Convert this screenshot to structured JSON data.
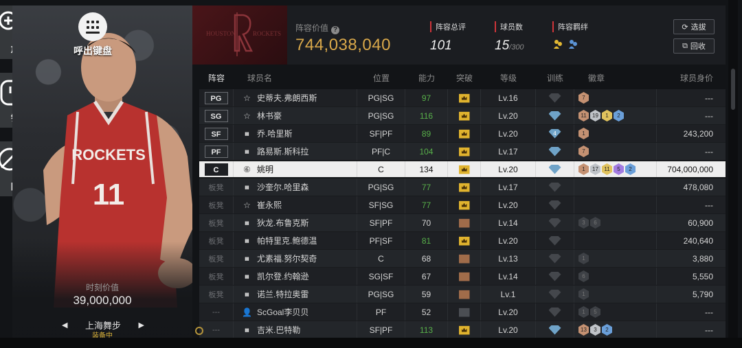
{
  "side": {
    "zoom_label": "放大",
    "lock_label": "锁住",
    "hide_label": "隐藏"
  },
  "card": {
    "keyboard_label": "呼出键盘",
    "value_label": "时刻价值",
    "value": "39,000,000",
    "team_name": "上海舞步",
    "equipped": "装备中"
  },
  "header": {
    "lineup_value_label": "阵容价值",
    "lineup_value": "744,038,040",
    "rating_label": "阵容总评",
    "rating": "101",
    "count_label": "球员数",
    "count": "15",
    "count_max": "/300",
    "bond_label": "阵容羁绊",
    "select_button": "选拔",
    "recycle_button": "回收"
  },
  "columns": [
    "阵容",
    "球员名",
    "位置",
    "能力",
    "突破",
    "等级",
    "训练",
    "徽章",
    "球员身价"
  ],
  "rows": [
    {
      "slot": "PG",
      "name": "史蒂夫.弗朗西斯",
      "pos": "PG|SG",
      "ability": "97",
      "green": true,
      "breakthrough": "gold",
      "level": "Lv.16",
      "training": "gray",
      "training_num": "",
      "badges": [
        [
          "brown",
          "7"
        ]
      ],
      "value": "---"
    },
    {
      "slot": "SG",
      "name": "林书豪",
      "pos": "PG|SG",
      "ability": "116",
      "green": true,
      "breakthrough": "gold",
      "level": "Lv.20",
      "training": "blue",
      "training_num": "",
      "badges": [
        [
          "brown",
          "11"
        ],
        [
          "silver",
          "19"
        ],
        [
          "gold",
          "1"
        ],
        [
          "blue",
          "2"
        ]
      ],
      "value": "---"
    },
    {
      "slot": "SF",
      "name": "乔.哈里斯",
      "pos": "SF|PF",
      "ability": "89",
      "green": true,
      "breakthrough": "gold",
      "level": "Lv.20",
      "training": "blue",
      "training_num": "4",
      "badges": [
        [
          "brown",
          "1"
        ]
      ],
      "value": "243,200"
    },
    {
      "slot": "PF",
      "name": "路易斯.斯科拉",
      "pos": "PF|C",
      "ability": "104",
      "green": true,
      "breakthrough": "gold",
      "level": "Lv.17",
      "training": "blue",
      "training_num": "",
      "badges": [
        [
          "brown",
          "7"
        ]
      ],
      "value": "---"
    },
    {
      "slot": "C",
      "name": "姚明",
      "pos": "C",
      "ability": "134",
      "green": false,
      "breakthrough": "gold",
      "level": "Lv.20",
      "training": "blue",
      "training_num": "",
      "badges": [
        [
          "brown",
          "1"
        ],
        [
          "silver",
          "17"
        ],
        [
          "gold",
          "11"
        ],
        [
          "purple",
          "5"
        ],
        [
          "blue",
          "2"
        ]
      ],
      "value": "704,000,000",
      "selected": true
    },
    {
      "slot": "板凳",
      "name": "沙奎尔.哈里森",
      "pos": "PG|SG",
      "ability": "77",
      "green": true,
      "breakthrough": "gold",
      "level": "Lv.17",
      "training": "gray",
      "training_num": "",
      "badges": [],
      "value": "478,080"
    },
    {
      "slot": "板凳",
      "name": "崔永熙",
      "pos": "SF|SG",
      "ability": "77",
      "green": true,
      "breakthrough": "gold",
      "level": "Lv.20",
      "training": "gray",
      "training_num": "",
      "badges": [],
      "value": "---"
    },
    {
      "slot": "板凳",
      "name": "狄龙.布鲁克斯",
      "pos": "SF|PF",
      "ability": "70",
      "green": false,
      "breakthrough": "brown",
      "level": "Lv.14",
      "training": "gray",
      "training_num": "",
      "badges": [
        [
          "dark",
          "3"
        ],
        [
          "dark",
          "6"
        ]
      ],
      "value": "60,900"
    },
    {
      "slot": "板凳",
      "name": "帕特里克.鲍德温",
      "pos": "PF|SF",
      "ability": "81",
      "green": true,
      "breakthrough": "gold",
      "level": "Lv.20",
      "training": "gray",
      "training_num": "",
      "badges": [],
      "value": "240,640"
    },
    {
      "slot": "板凳",
      "name": "尤素福.努尔契奇",
      "pos": "C",
      "ability": "68",
      "green": false,
      "breakthrough": "brown",
      "level": "Lv.13",
      "training": "gray",
      "training_num": "",
      "badges": [
        [
          "dark",
          "1"
        ]
      ],
      "value": "3,880"
    },
    {
      "slot": "板凳",
      "name": "凯尔登.约翰逊",
      "pos": "SG|SF",
      "ability": "67",
      "green": false,
      "breakthrough": "brown",
      "level": "Lv.14",
      "training": "gray",
      "training_num": "",
      "badges": [
        [
          "dark",
          "6"
        ]
      ],
      "value": "5,550"
    },
    {
      "slot": "板凳",
      "name": "诺兰.特拉奥雷",
      "pos": "PG|SG",
      "ability": "59",
      "green": false,
      "breakthrough": "brown",
      "level": "Lv.1",
      "training": "gray",
      "training_num": "",
      "badges": [
        [
          "dark",
          "1"
        ]
      ],
      "value": "5,790"
    },
    {
      "slot": "---",
      "name": "ScGoal李贝贝",
      "pos": "PF",
      "ability": "52",
      "green": false,
      "breakthrough": "gray",
      "level": "Lv.20",
      "training": "gray",
      "training_num": "",
      "badges": [
        [
          "dark",
          "1"
        ],
        [
          "dark",
          "5"
        ]
      ],
      "value": "---"
    },
    {
      "slot": "---",
      "name": "吉米.巴特勒",
      "pos": "SF|PF",
      "ability": "113",
      "green": true,
      "breakthrough": "gold",
      "level": "Lv.20",
      "training": "blue",
      "training_num": "",
      "badges": [
        [
          "brown",
          "13"
        ],
        [
          "silver",
          "3"
        ],
        [
          "blue",
          "2"
        ]
      ],
      "value": "---"
    }
  ],
  "colors": {
    "accent_gold": "#d9a84a",
    "accent_green": "#58b04a",
    "team_red": "#b8322f"
  }
}
